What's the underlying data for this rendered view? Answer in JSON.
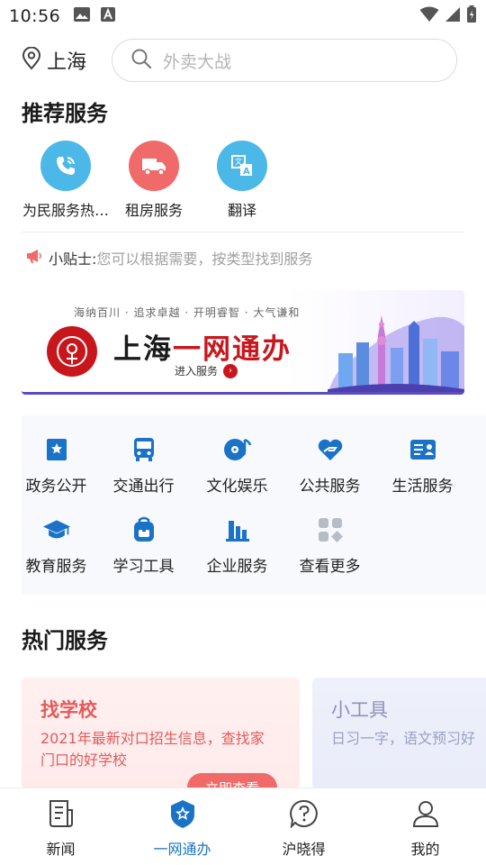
{
  "status_bar": {
    "time": "10:56",
    "icons": [
      "image-icon",
      "text-a-icon",
      "wifi-icon",
      "signal-icon",
      "battery-icon"
    ]
  },
  "header": {
    "city": "上海",
    "search_placeholder": "外卖大战"
  },
  "recommended": {
    "title": "推荐服务",
    "items": [
      {
        "label": "为民服务热…",
        "icon": "phone-icon",
        "color": "#4bb8e8"
      },
      {
        "label": "租房服务",
        "icon": "truck-icon",
        "color": "#f06a6a"
      },
      {
        "label": "翻译",
        "icon": "translate-icon",
        "color": "#4bb8e8"
      }
    ]
  },
  "tips": {
    "label": "小贴士:",
    "text": "您可以根据需要，按类型找到服务"
  },
  "banner": {
    "slogan": "海纳百川 · 追求卓越 · 开明睿智 · 大气谦和",
    "title_black": "上海",
    "title_red": "一网通办",
    "enter_label": "进入服务"
  },
  "categories": [
    {
      "label": "政务公开",
      "icon": "bookmark-star-icon"
    },
    {
      "label": "交通出行",
      "icon": "bus-icon"
    },
    {
      "label": "文化娱乐",
      "icon": "music-disc-icon"
    },
    {
      "label": "公共服务",
      "icon": "heart-hand-icon"
    },
    {
      "label": "生活服务",
      "icon": "id-card-icon"
    },
    {
      "label": "教育服务",
      "icon": "graduation-cap-icon"
    },
    {
      "label": "学习工具",
      "icon": "backpack-icon"
    },
    {
      "label": "企业服务",
      "icon": "building-chart-icon"
    },
    {
      "label": "查看更多",
      "icon": "grid-more-icon"
    }
  ],
  "hot": {
    "title": "热门服务",
    "cards": [
      {
        "title": "找学校",
        "desc": "2021年最新对口招生信息，查找家门口的好学校",
        "button": "立即查看"
      },
      {
        "title": "小工具",
        "desc": "日习一字，语文预习好"
      }
    ]
  },
  "bottom_nav": {
    "items": [
      {
        "label": "新闻",
        "icon": "news-icon"
      },
      {
        "label": "一网通办",
        "icon": "service-shield-icon"
      },
      {
        "label": "沪晓得",
        "icon": "question-bubble-icon"
      },
      {
        "label": "我的",
        "icon": "user-icon"
      }
    ],
    "active_color": "#1a73c7"
  }
}
